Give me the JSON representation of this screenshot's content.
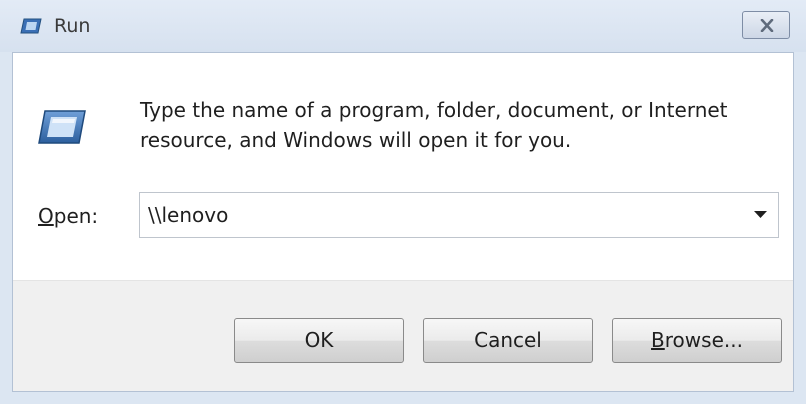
{
  "window": {
    "title": "Run",
    "icon": "run-icon",
    "close_icon": "close-icon"
  },
  "dialog": {
    "description": "Type the name of a program, folder, document, or Internet resource, and Windows will open it for you.",
    "open_label_mnemonic": "O",
    "open_label_rest": "pen:",
    "open_value": "\\\\lenovo",
    "dropdown_icon": "chevron-down-icon"
  },
  "buttons": {
    "ok": "OK",
    "cancel": "Cancel",
    "browse_mnemonic": "B",
    "browse_rest": "rowse..."
  },
  "colors": {
    "titlebar": "#d6e1ef",
    "button_bar": "#f0f0f0",
    "icon_blue": "#3a6fb5"
  }
}
